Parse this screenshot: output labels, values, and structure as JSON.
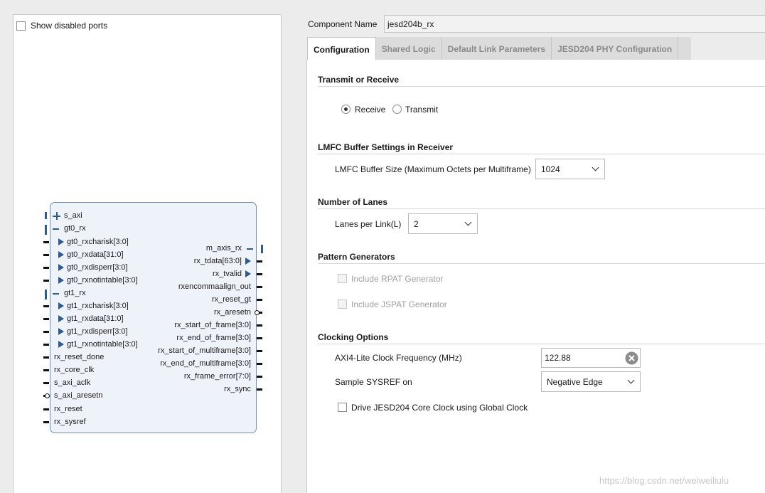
{
  "left_panel": {
    "show_disabled_label": "Show disabled ports",
    "block": {
      "left_ports": [
        "s_axi",
        "gt0_rx",
        "gt0_rxcharisk[3:0]",
        "gt0_rxdata[31:0]",
        "gt0_rxdisperr[3:0]",
        "gt0_rxnotintable[3:0]",
        "gt1_rx",
        "gt1_rxcharisk[3:0]",
        "gt1_rxdata[31:0]",
        "gt1_rxdisperr[3:0]",
        "gt1_rxnotintable[3:0]",
        "rx_reset_done",
        "rx_core_clk",
        "s_axi_aclk",
        "s_axi_aresetn",
        "rx_reset",
        "rx_sysref"
      ],
      "right_ports": [
        "m_axis_rx",
        "rx_tdata[63:0]",
        "rx_tvalid",
        "rxencommaalign_out",
        "rx_reset_gt",
        "rx_aresetn",
        "rx_start_of_frame[3:0]",
        "rx_end_of_frame[3:0]",
        "rx_start_of_multiframe[3:0]",
        "rx_end_of_multiframe[3:0]",
        "rx_frame_error[7:0]",
        "rx_sync"
      ]
    }
  },
  "component": {
    "label": "Component Name",
    "value": "jesd204b_rx"
  },
  "tabs": [
    "Configuration",
    "Shared Logic",
    "Default Link Parameters",
    "JESD204 PHY Configuration"
  ],
  "sections": {
    "transmit_receive": {
      "title": "Transmit or Receive",
      "receive": "Receive",
      "transmit": "Transmit",
      "selected": "Receive"
    },
    "lmfc": {
      "title": "LMFC Buffer Settings in Receiver",
      "label": "LMFC Buffer Size (Maximum Octets per Multiframe)",
      "value": "1024"
    },
    "lanes": {
      "title": "Number of Lanes",
      "label": "Lanes per Link(L)",
      "value": "2"
    },
    "patterns": {
      "title": "Pattern Generators",
      "rpat": "Include RPAT Generator",
      "jspat": "Include JSPAT Generator"
    },
    "clocking": {
      "title": "Clocking Options",
      "axi_label": "AXI4-Lite Clock Frequency (MHz)",
      "axi_value": "122.88",
      "sysref_label": "Sample SYSREF on",
      "sysref_value": "Negative Edge",
      "global_clock_label": "Drive JESD204 Core Clock using Global Clock"
    }
  },
  "watermark": "https://blog.csdn.net/weiweiliulu"
}
